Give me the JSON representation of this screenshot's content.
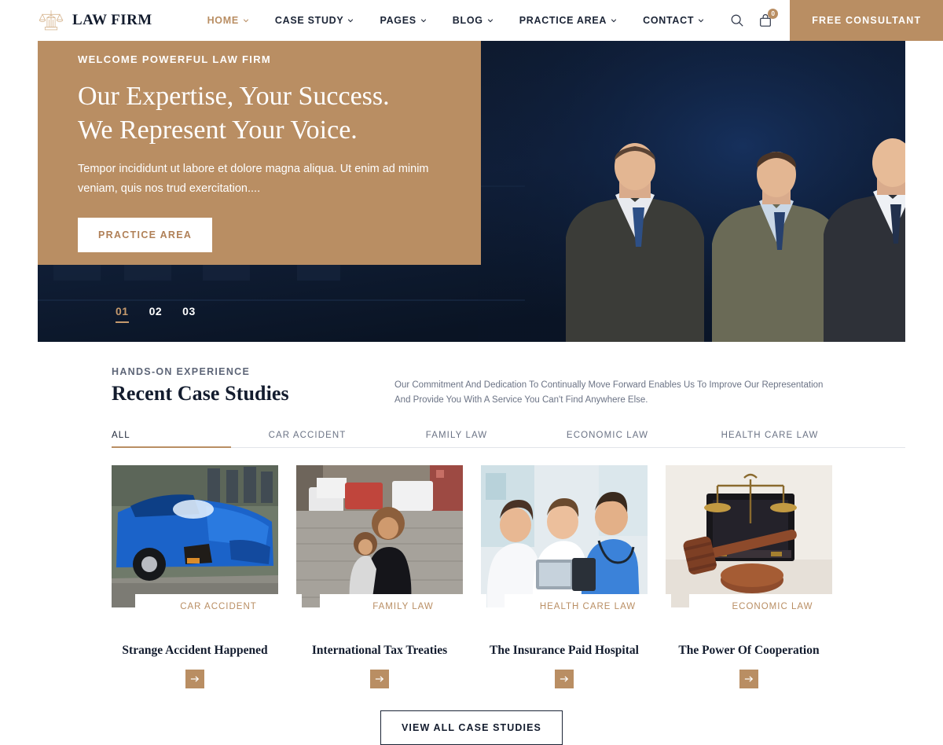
{
  "header": {
    "logo_icon": "scales-of-justice-building-icon",
    "brand_name": "LAW FIRM",
    "nav": [
      {
        "label": "HOME",
        "has_dropdown": true,
        "active": true
      },
      {
        "label": "CASE STUDY",
        "has_dropdown": true,
        "active": false
      },
      {
        "label": "PAGES",
        "has_dropdown": true,
        "active": false
      },
      {
        "label": "BLOG",
        "has_dropdown": true,
        "active": false
      },
      {
        "label": "PRACTICE AREA",
        "has_dropdown": true,
        "active": false
      },
      {
        "label": "CONTACT",
        "has_dropdown": true,
        "active": false
      }
    ],
    "search_icon": "search-icon",
    "cart_icon": "shopping-bag-icon",
    "cart_count": "0",
    "cta_label": "FREE CONSULTANT",
    "accent_color": "#b98e63",
    "text_color": "#1b2436"
  },
  "hero": {
    "eyebrow": "WELCOME POWERFUL LAW FIRM",
    "title": "Our Expertise, Your Success. We Represent Your Voice.",
    "description": "Tempor incididunt ut labore et dolore magna aliqua. Ut enim ad minim veniam, quis nos trud exercitation....",
    "cta_label": "PRACTICE AREA",
    "panel_color": "#b98e63",
    "background_color": "#0d1626",
    "slides": [
      {
        "label": "01",
        "active": true
      },
      {
        "label": "02",
        "active": false
      },
      {
        "label": "03",
        "active": false
      }
    ]
  },
  "case_studies": {
    "eyebrow": "HANDS-ON EXPERIENCE",
    "title": "Recent Case Studies",
    "description": "Our Commitment And Dedication To Continually Move Forward Enables Us To Improve Our Representation And Provide You With A Service You Can't Find Anywhere Else.",
    "tabs": [
      {
        "label": "ALL",
        "active": true
      },
      {
        "label": "CAR ACCIDENT",
        "active": false
      },
      {
        "label": "FAMILY LAW",
        "active": false
      },
      {
        "label": "ECONOMIC LAW",
        "active": false
      },
      {
        "label": "HEALTH CARE LAW",
        "active": false
      }
    ],
    "cards": [
      {
        "category": "CAR ACCIDENT",
        "title": "Strange Accident Happened",
        "image_subject": "damaged-blue-sports-car-crash-scene",
        "arrow_icon": "arrow-right-icon"
      },
      {
        "category": "FAMILY LAW",
        "title": "International Tax Treaties",
        "image_subject": "mother-holding-child-on-cobblestone-street",
        "arrow_icon": "arrow-right-icon"
      },
      {
        "category": "HEALTH CARE LAW",
        "title": "The Insurance Paid Hospital",
        "image_subject": "three-medical-professionals-with-tablet",
        "arrow_icon": "arrow-right-icon"
      },
      {
        "category": "ECONOMIC LAW",
        "title": "The Power Of Cooperation",
        "image_subject": "gavel-and-brass-scales-of-justice",
        "arrow_icon": "arrow-right-icon"
      }
    ],
    "view_all_label": "VIEW ALL CASE STUDIES"
  }
}
